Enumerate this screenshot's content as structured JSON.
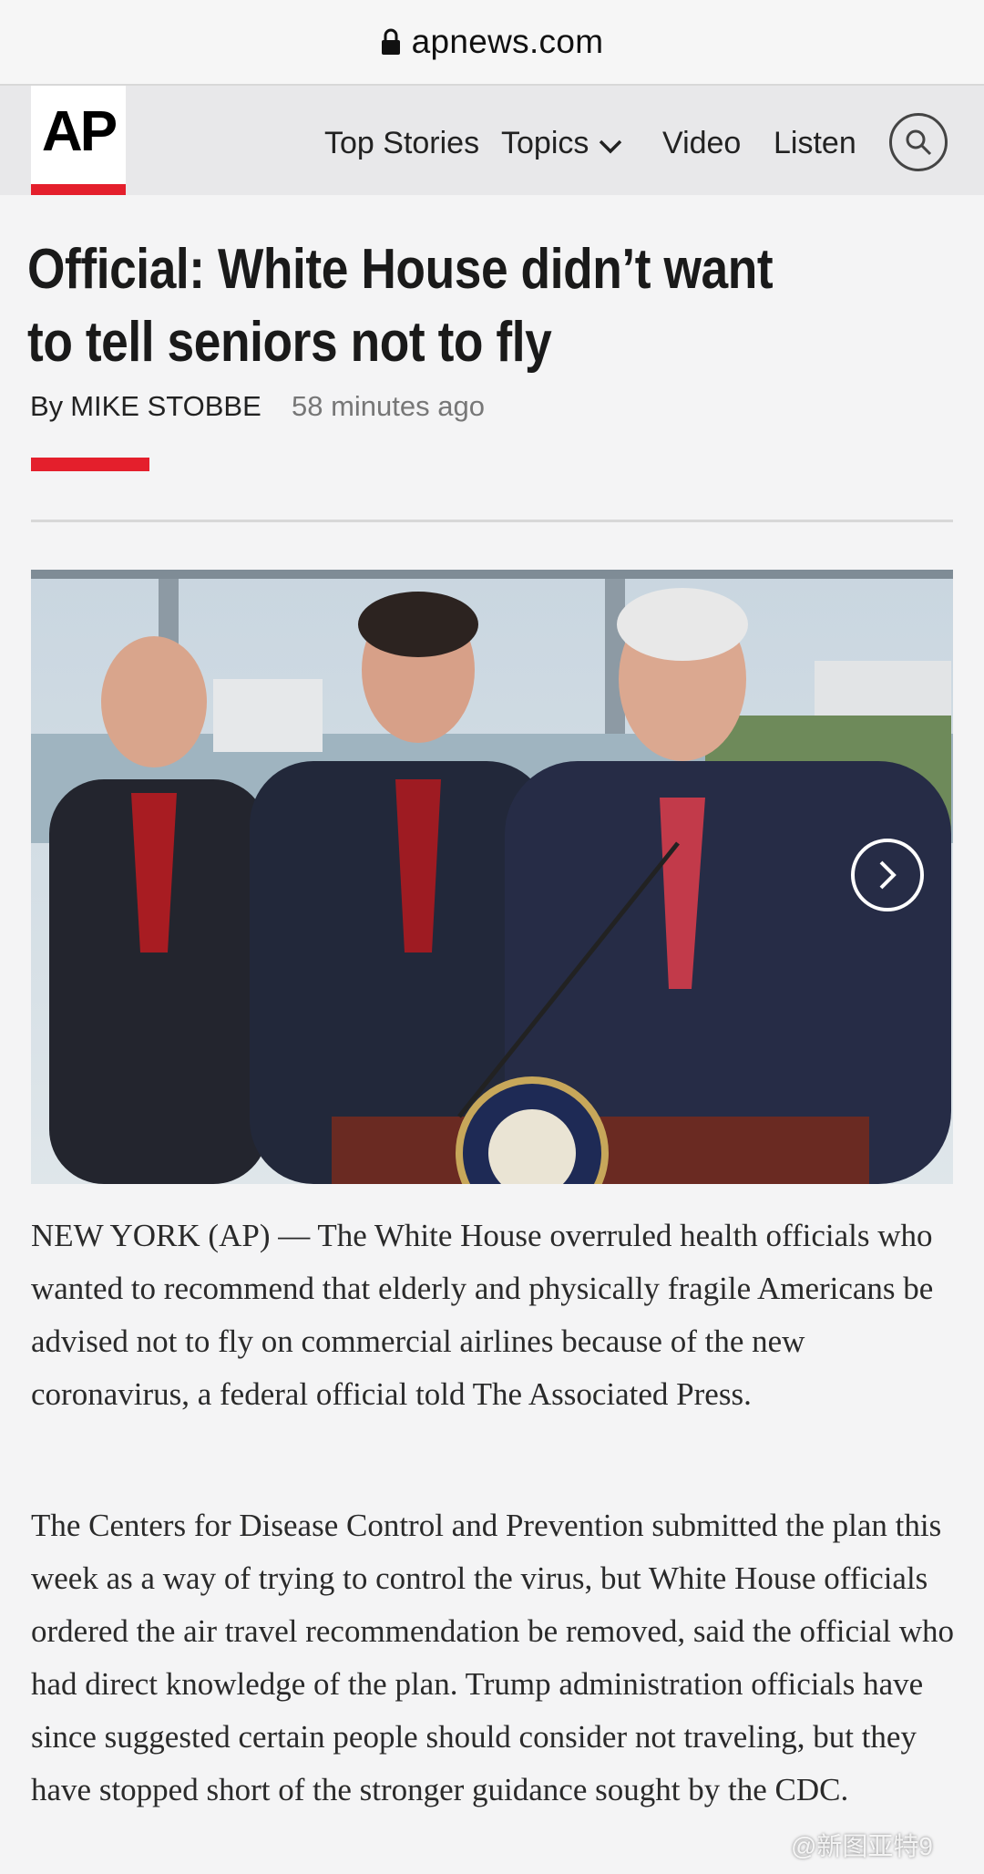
{
  "browser": {
    "url": "apnews.com"
  },
  "header": {
    "logo_text": "AP",
    "nav": {
      "top_stories": "Top Stories",
      "topics": "Topics",
      "video": "Video",
      "listen": "Listen"
    }
  },
  "article": {
    "headline": "Official: White House didn’t want to tell seniors not to fly",
    "byline_prefix": "By",
    "author": "MIKE STOBBE",
    "timestamp": "58 minutes ago",
    "paragraphs": [
      "NEW YORK (AP) — The White House overruled health officials who wanted to recommend that elderly and physically fragile Americans be advised not to fly on commercial airlines because of the new coronavirus, a federal official told The Associated Press.",
      "The Centers for Disease Control and Prevention submitted the plan this week as a way of trying to control the virus, but White House officials ordered the air travel recommendation be removed, said the official who had direct knowledge of the plan. Trump administration officials have since suggested certain people should consider not traveling, but they have stopped short of the stronger guidance sought by the CDC."
    ]
  },
  "watermark": "@新图亚特9",
  "colors": {
    "accent": "#e41f2c",
    "header_bg": "#e8e8ea",
    "page_bg": "#f4f4f5"
  }
}
